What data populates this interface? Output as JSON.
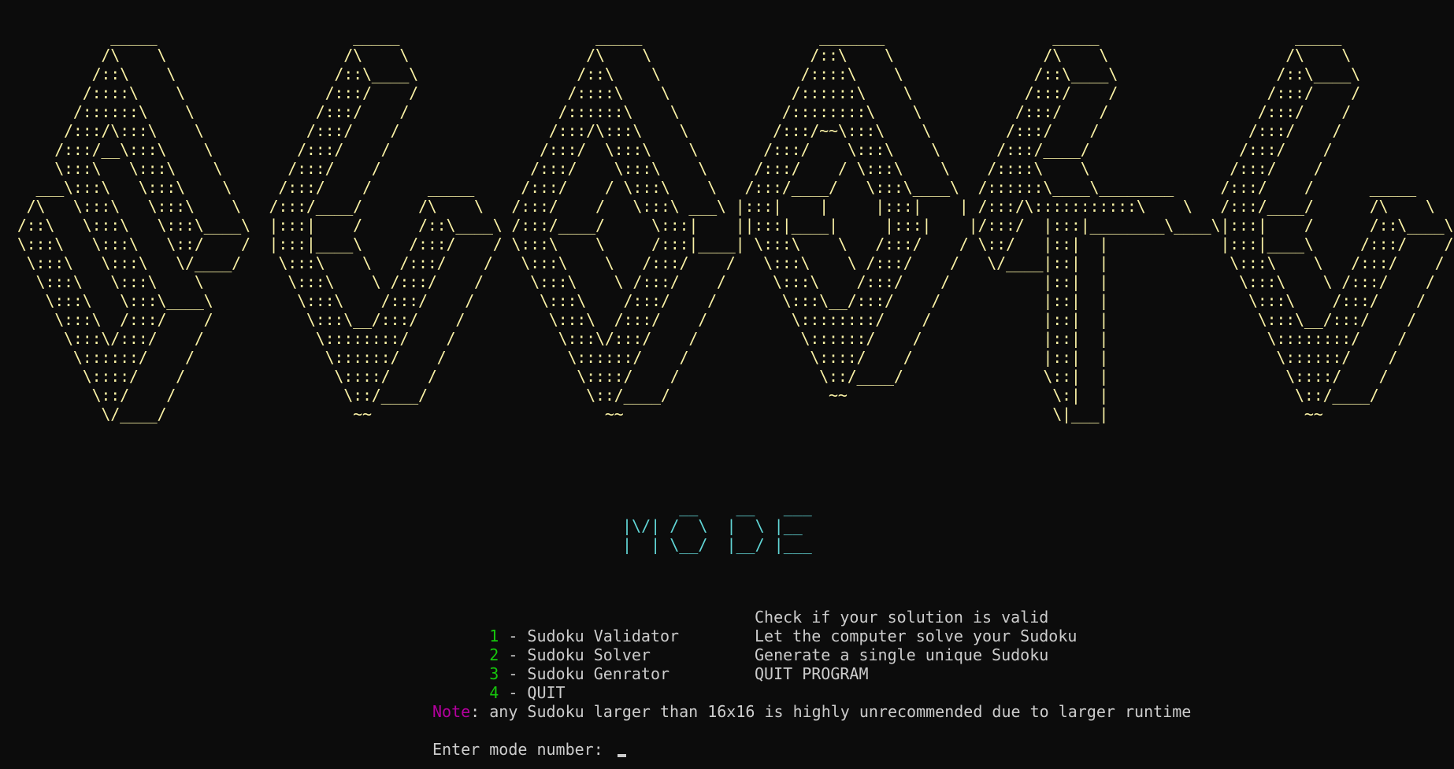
{
  "terminal": {
    "banner_lines": [
      "           _____                     _____                     _____                   _______                  _____                     _____          ",
      "          /\\    \\                   /\\    \\                   /\\    \\                 /::\\    \\                /\\    \\                   /\\    \\         ",
      "         /::\\    \\                 /::\\____\\                 /::\\    \\               /::::\\    \\              /::\\____\\                 /::\\____\\        ",
      "        /::::\\    \\               /:::/    /                /::::\\    \\             /::::::\\    \\            /:::/    /                /:::/    /        ",
      "       /::::::\\    \\             /:::/    /                /::::::\\    \\           /::::::::\\    \\          /:::/    /                /:::/    /         ",
      "      /:::/\\:::\\    \\           /:::/    /                /:::/\\:::\\    \\         /:::/~~\\:::\\    \\        /:::/    /                /:::/    /          ",
      "     /:::/__\\:::\\    \\         /:::/    /                /:::/  \\:::\\    \\       /:::/    \\:::\\    \\      /:::/____/                /:::/    /           ",
      "     \\:::\\   \\:::\\    \\       /:::/    /                /:::/    \\:::\\    \\     /:::/    / \\:::\\    \\    /::::\\    \\               /:::/    /            ",
      "   ___\\:::\\   \\:::\\    \\     /:::/    /      _____     /:::/    / \\:::\\    \\   /:::/____/   \\:::\\____\\  /::::::\\____\\________     /:::/    /      _____  ",
      "  /\\   \\:::\\   \\:::\\    \\   /:::/____/      /\\    \\   /:::/    /   \\:::\\ ___\\ |:::|    |     |:::|    | /:::/\\:::::::::::\\    \\   /:::/____/      /\\    \\ ",
      " /::\\   \\:::\\   \\:::\\____\\  |:::|    /      /::\\____\\ /:::/____/     \\:::|    ||:::|____|     |:::|    |/:::/  |:::|________\\____\\|:::|    /      /::\\____\\",
      " \\:::\\   \\:::\\   \\::/    /  |:::|____\\     /:::/    / \\:::\\    \\     /:::|____| \\:::\\    \\   /:::/    / \\::/   |::|  |            |:::|____\\     /:::/    /",
      "  \\:::\\   \\:::\\   \\/____/    \\:::\\    \\   /:::/    /   \\:::\\    \\   /:::/    /   \\:::\\    \\ /:::/    /   \\/____|::|  |             \\:::\\    \\   /:::/    / ",
      "   \\:::\\   \\:::\\    \\         \\:::\\    \\ /:::/    /     \\:::\\    \\ /:::/    /     \\:::\\    /:::/    /          |::|  |              \\:::\\    \\ /:::/    /  ",
      "    \\:::\\   \\:::\\____\\         \\:::\\    /:::/    /       \\:::\\    /:::/    /       \\:::\\__/:::/    /           |::|  |               \\:::\\    /:::/    /   ",
      "     \\:::\\  /:::/    /          \\:::\\__/:::/    /         \\:::\\  /:::/    /         \\::::::::/    /            |::|  |                \\:::\\__/:::/    /    ",
      "      \\:::\\/:::/    /            \\::::::::/    /           \\:::\\/:::/    /           \\::::::/    /             |::|  |                 \\::::::::/    /     ",
      "       \\::::::/    /              \\::::::/    /             \\::::::/    /             \\::::/    /              |::|  |                  \\::::::/    /      ",
      "        \\::::/    /                \\::::/    /               \\::::/    /               \\::/____/               \\::|  |                   \\::::/    /       ",
      "         \\::/    /                  \\::/____/                 \\::/____/                 ~~                      \\:|  |                    \\::/____/        ",
      "          \\/____/                    ~~                         ~~                                              \\|___|                     ~~              "
    ],
    "mode_art_lines": [
      "      __    __   ___ ",
      "|\\/| /  \\  |  \\ |__  ",
      "|  | \\__/  |__/ |___ "
    ],
    "menu": [
      {
        "num": "1",
        "label": " - Sudoku Validator",
        "desc": "Check if your solution is valid"
      },
      {
        "num": "2",
        "label": " - Sudoku Solver",
        "desc": "Let the computer solve your Sudoku"
      },
      {
        "num": "3",
        "label": " - Sudoku Genrator",
        "desc": "Generate a single unique Sudoku"
      },
      {
        "num": "4",
        "label": " - QUIT",
        "desc": "QUIT PROGRAM"
      }
    ],
    "note_label": "Note",
    "note_text": ": any Sudoku larger than 16x16 is highly unrecommended due to larger runtime",
    "prompt_text": "Enter mode number: ",
    "colors": {
      "background": "#0c0c0c",
      "banner": "#f9f1a5",
      "mode_art": "#61d6d6",
      "menu_number": "#16c60c",
      "note_label": "#b4009e",
      "text": "#cccccc"
    }
  }
}
